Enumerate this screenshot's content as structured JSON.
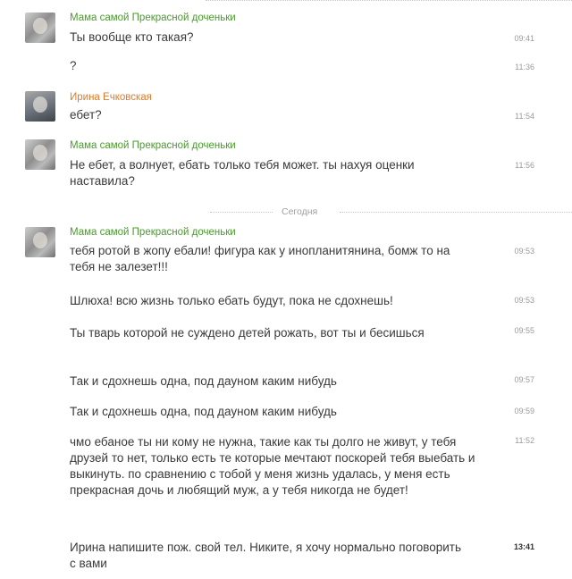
{
  "messages": [
    {
      "sender": "Мама самой Прекрасной доченьки",
      "text": "Ты вообще кто такая?",
      "time": "09:41"
    },
    {
      "text": "?",
      "time": "11:36"
    },
    {
      "sender": "Ирина Ечковская",
      "text": "ебет?",
      "time": "11:54"
    },
    {
      "sender": "Мама самой Прекрасной доченьки",
      "text": "Не ебет, а волнует, ебать только тебя может. ты нахуя оценки наставила?",
      "time": "11:56"
    },
    {
      "sender": "Мама самой Прекрасной доченьки",
      "text": "тебя ротой в жопу ебали! фигура как у инопланитянина, бомж то на тебя не залезет!!!",
      "time": "09:53"
    },
    {
      "text": "Шлюха! всю жизнь только ебать будут, пока не сдохнешь!",
      "time": "09:53"
    },
    {
      "text": "Ты тварь которой не суждено детей рожать, вот ты и бесишься",
      "time": "09:55"
    },
    {
      "text": "Так и сдохнешь одна, под дауном каким нибудь",
      "time": "09:57"
    },
    {
      "text": "Так и сдохнешь одна, под дауном каким нибудь",
      "time": "09:59"
    },
    {
      "text": "чмо ебаное ты ни кому не нужна, такие как ты долго не живут, у тебя друзей то нет, только есть те которые мечтают поскорей тебя выебать и выкинуть. по сравнению с тобой у меня жизнь удалась, у меня есть прекрасная дочь и любящий муж, а у тебя никогда не будет!",
      "time": "11:52"
    },
    {
      "text": "Ирина напишите пож. свой тел. Никите, я хочу нормально поговорить с вами",
      "time": "13:41"
    }
  ],
  "divider": {
    "label": "Сегодня"
  }
}
